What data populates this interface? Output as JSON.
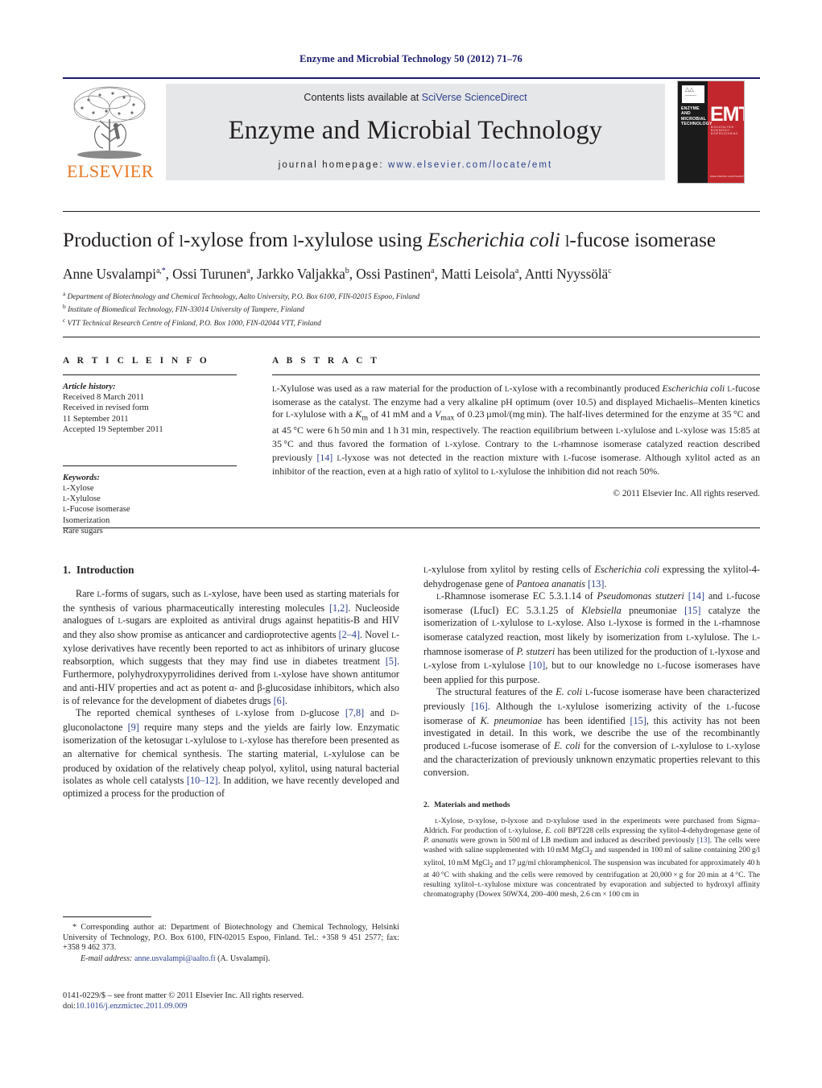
{
  "running_head": "Enzyme and Microbial Technology 50 (2012) 71–76",
  "masthead": {
    "contents_prefix": "Contents lists available at ",
    "contents_link": "SciVerse ScienceDirect",
    "journal_title": "Enzyme and Microbial Technology",
    "homepage_prefix": "journal homepage: ",
    "homepage_url": "www.elsevier.com/locate/emt",
    "publisher_wordmark": "ELSEVIER",
    "cover": {
      "journal_name": "ENZYME AND MICROBIAL TECHNOLOGY",
      "abbrev": "EMT",
      "tagline": "BIOCATALYSIS · BIOENERGY · BIOPROCESSING",
      "bottom_text": "www.elsevier.com/locate/emt"
    }
  },
  "article": {
    "title_part1": "Production of ",
    "title_sc1": "l",
    "title_part2": "-xylose from ",
    "title_sc2": "l",
    "title_part3": "-xylulose using ",
    "title_italic": "Escherichia coli",
    "title_part4": " ",
    "title_sc3": "l",
    "title_part5": "-fucose isomerase",
    "authors_plain": "Anne Usvalampi a,*, Ossi Turunen a, Jarkko Valjakka b, Ossi Pastinen a, Matti Leisola a, Antti Nyyssölä c",
    "affiliations": [
      {
        "marker": "a",
        "text": "Department of Biotechnology and Chemical Technology, Aalto University, P.O. Box 6100, FIN-02015 Espoo, Finland"
      },
      {
        "marker": "b",
        "text": "Institute of Biomedical Technology, FIN-33014 University of Tampere, Finland"
      },
      {
        "marker": "c",
        "text": "VTT Technical Research Centre of Finland, P.O. Box 1000, FIN-02044 VTT, Finland"
      }
    ]
  },
  "article_info": {
    "heading": "A R T I C L E   I N F O",
    "history_label": "Article history:",
    "history": [
      "Received 8 March 2011",
      "Received in revised form",
      "11 September 2011",
      "Accepted 19 September 2011"
    ],
    "keywords_label": "Keywords:",
    "keywords": [
      "l-Xylose",
      "l-Xylulose",
      "l-Fucose isomerase",
      "Isomerization",
      "Rare sugars"
    ]
  },
  "abstract": {
    "heading": "A B S T R A C T",
    "copyright": "© 2011 Elsevier Inc. All rights reserved."
  },
  "sections": {
    "introduction": {
      "number": "1.",
      "title": "Introduction"
    },
    "materials": {
      "number": "2.",
      "title": "Materials and methods"
    }
  },
  "footnote": {
    "corresponding": "* Corresponding author at: Department of Biotechnology and Chemical Technology, Helsinki University of Technology, P.O. Box 6100, FIN-02015 Espoo, Finland. Tel.: +358 9 451 2577; fax: +358 9 462 373.",
    "email_label": "E-mail address:",
    "email": "anne.usvalampi@aalto.fi",
    "email_attrib": "(A. Usvalampi)."
  },
  "imprint": {
    "issn_line": "0141-0229/$ – see front matter © 2011 Elsevier Inc. All rights reserved.",
    "doi_label": "doi:",
    "doi_value": "10.1016/j.enzmictec.2011.09.009"
  }
}
